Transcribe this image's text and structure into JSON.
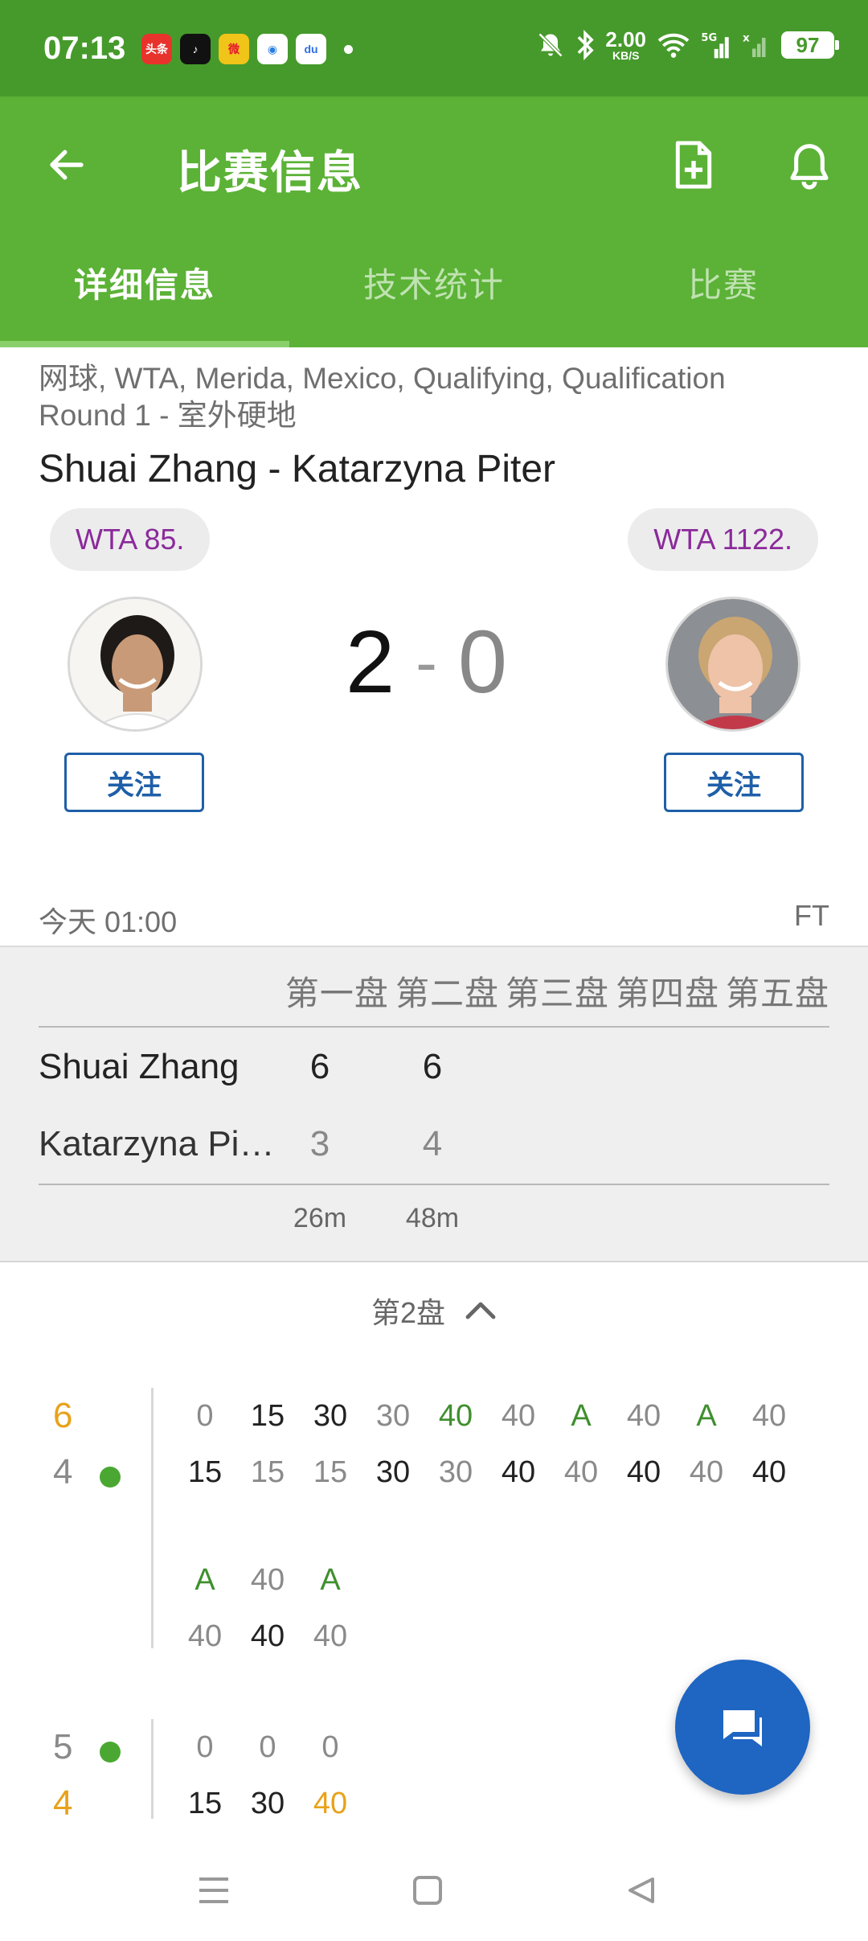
{
  "status": {
    "time": "07:13",
    "apps": [
      {
        "name": "toutiao",
        "label": "头条",
        "color": "#e8332d"
      },
      {
        "name": "douyin",
        "label": "♪",
        "color": "#111111"
      },
      {
        "name": "weibo",
        "label": "微",
        "color": "#e6162d"
      },
      {
        "name": "browser",
        "label": "◉",
        "color": "#2a7de1"
      },
      {
        "name": "baidu",
        "label": "du",
        "color": "#2f6fe4"
      }
    ],
    "net_speed": "2.00",
    "net_unit": "KB/S",
    "battery": "97"
  },
  "header": {
    "title": "比赛信息"
  },
  "tabs": [
    {
      "label": "详细信息",
      "active": true
    },
    {
      "label": "技术统计",
      "active": false
    },
    {
      "label": "比赛",
      "active": false
    }
  ],
  "match": {
    "competition": "网球, WTA, Merida, Mexico, Qualifying, Qualification Round 1 - 室外硬地",
    "title": "Shuai Zhang - Katarzyna Piter",
    "home": {
      "name": "Shuai Zhang",
      "rank": "WTA 85.",
      "follow": "关注"
    },
    "away": {
      "name": "Katarzyna Piter",
      "rank": "WTA 1122.",
      "follow": "关注"
    },
    "score_home": "2",
    "score_sep": "-",
    "score_away": "0",
    "time": "今天 01:00",
    "status": "FT"
  },
  "sets_table": {
    "headers": [
      "第一盘",
      "第二盘",
      "第三盘",
      "第四盘",
      "第五盘"
    ],
    "rows": [
      {
        "name": "Shuai Zhang",
        "sets": [
          "6",
          "6"
        ]
      },
      {
        "name": "Katarzyna Piter",
        "sets": [
          "3",
          "4"
        ]
      }
    ],
    "durations": [
      "26m",
      "48m"
    ]
  },
  "set_toggle": {
    "label": "第2盘"
  },
  "games": [
    {
      "home_games": "6",
      "away_games": "4",
      "home_color": "#e8a21a",
      "away_color": "#8a8a8a",
      "server": "away",
      "points_row1": [
        {
          "h": "0",
          "hc": "gray",
          "a": "15",
          "ac": "dark"
        },
        {
          "h": "15",
          "hc": "dark",
          "a": "15",
          "ac": "gray"
        },
        {
          "h": "30",
          "hc": "dark",
          "a": "15",
          "ac": "gray"
        },
        {
          "h": "30",
          "hc": "gray",
          "a": "30",
          "ac": "dark"
        },
        {
          "h": "40",
          "hc": "green",
          "a": "30",
          "ac": "gray"
        },
        {
          "h": "40",
          "hc": "gray",
          "a": "40",
          "ac": "dark"
        },
        {
          "h": "A",
          "hc": "green",
          "a": "40",
          "ac": "gray"
        },
        {
          "h": "40",
          "hc": "gray",
          "a": "40",
          "ac": "dark"
        },
        {
          "h": "A",
          "hc": "green",
          "a": "40",
          "ac": "gray"
        },
        {
          "h": "40",
          "hc": "gray",
          "a": "40",
          "ac": "dark"
        }
      ],
      "points_row2": [
        {
          "h": "A",
          "hc": "green",
          "a": "40",
          "ac": "gray"
        },
        {
          "h": "40",
          "hc": "gray",
          "a": "40",
          "ac": "dark"
        },
        {
          "h": "A",
          "hc": "green",
          "a": "40",
          "ac": "gray"
        }
      ]
    },
    {
      "home_games": "5",
      "away_games": "4",
      "home_color": "#8a8a8a",
      "away_color": "#e8a21a",
      "server": "home",
      "points_row1": [
        {
          "h": "0",
          "hc": "gray",
          "a": "15",
          "ac": "dark"
        },
        {
          "h": "0",
          "hc": "gray",
          "a": "30",
          "ac": "dark"
        },
        {
          "h": "0",
          "hc": "gray",
          "a": "40",
          "ac": "orange"
        }
      ]
    }
  ]
}
